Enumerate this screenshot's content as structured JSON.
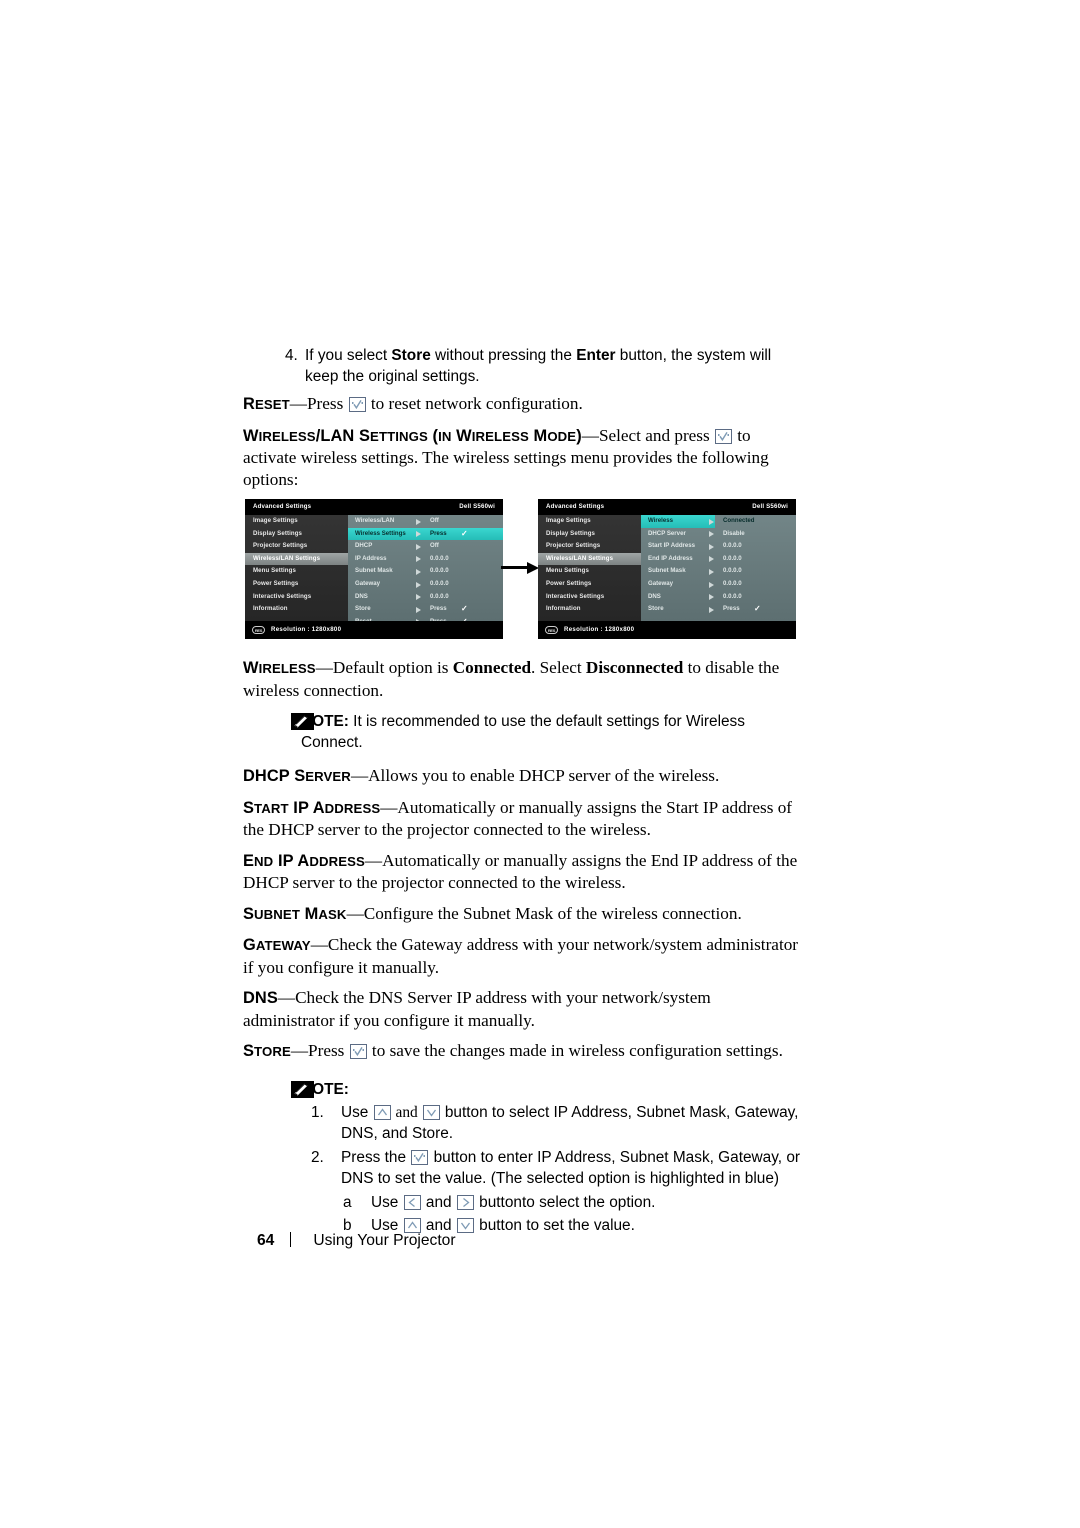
{
  "document": {
    "footer": {
      "page_number": "64",
      "section": "Using Your Projector"
    }
  },
  "numbered_item": {
    "number": "4.",
    "text_parts": {
      "a": "If you select ",
      "b_bold": "Store",
      "c": " without pressing the ",
      "d_bold": "Enter",
      "e": " button, the system will keep the original settings."
    },
    "full_text": "If you select Store without pressing the Enter button, the system will keep the original settings."
  },
  "definitions": [
    {
      "term": "RESET",
      "term_caps": "R",
      "term_smallcaps": "ESET",
      "body_before_icon": "—Press ",
      "icon": "enter-key-icon",
      "body_after_icon": " to reset network configuration."
    },
    {
      "term": "WIRELESS/LAN SETTINGS (IN WIRELESS MODE)",
      "body_before_icon": "—Select and press ",
      "icon": "enter-key-icon",
      "body_after_icon": " to activate wireless settings. The wireless settings menu provides the following options:"
    }
  ],
  "osd_left": {
    "title": "Advanced Settings",
    "model": "Dell  S560wi",
    "menu_items": [
      {
        "label": "Image Settings",
        "selected": false
      },
      {
        "label": "Display Settings",
        "selected": false
      },
      {
        "label": "Projector Settings",
        "selected": false
      },
      {
        "label": "Wireless/LAN Settings",
        "selected": true
      },
      {
        "label": "Menu Settings",
        "selected": false
      },
      {
        "label": "Power Settings",
        "selected": false
      },
      {
        "label": "Interactive Settings",
        "selected": false
      },
      {
        "label": "Information",
        "selected": false
      }
    ],
    "options": [
      {
        "label": "Wireless/LAN",
        "value": "Off",
        "check": false,
        "selected": false
      },
      {
        "label": "Wireless Settings",
        "value": "Press",
        "check": true,
        "selected": true
      },
      {
        "label": "DHCP",
        "value": "Off",
        "check": false,
        "selected": false
      },
      {
        "label": "IP Address",
        "value": "0.0.0.0",
        "check": false,
        "selected": false
      },
      {
        "label": "Subnet Mask",
        "value": "0.0.0.0",
        "check": false,
        "selected": false
      },
      {
        "label": "Gateway",
        "value": "0.0.0.0",
        "check": false,
        "selected": false
      },
      {
        "label": "DNS",
        "value": "0.0.0.0",
        "check": false,
        "selected": false
      },
      {
        "label": "Store",
        "value": "Press",
        "check": true,
        "selected": false
      },
      {
        "label": "Reset",
        "value": "Press",
        "check": true,
        "selected": false
      }
    ],
    "footer_icon_text": "RES",
    "footer_text": "Resolution : 1280x800"
  },
  "osd_right": {
    "title": "Advanced Settings",
    "model": "Dell  S560wi",
    "menu_items": [
      {
        "label": "Image Settings",
        "selected": false
      },
      {
        "label": "Display Settings",
        "selected": false
      },
      {
        "label": "Projector Settings",
        "selected": false
      },
      {
        "label": "Wireless/LAN Settings",
        "selected": true
      },
      {
        "label": "Menu Settings",
        "selected": false
      },
      {
        "label": "Power Settings",
        "selected": false
      },
      {
        "label": "Interactive Settings",
        "selected": false
      },
      {
        "label": "Information",
        "selected": false
      }
    ],
    "options": [
      {
        "label": "Wireless",
        "value": "Connected",
        "check": false,
        "selected": true
      },
      {
        "label": "DHCP Server",
        "value": "Disable",
        "check": false,
        "selected": false
      },
      {
        "label": "Start IP Address",
        "value": "0.0.0.0",
        "check": false,
        "selected": false
      },
      {
        "label": "End IP Address",
        "value": "0.0.0.0",
        "check": false,
        "selected": false
      },
      {
        "label": "Subnet Mask",
        "value": "0.0.0.0",
        "check": false,
        "selected": false
      },
      {
        "label": "Gateway",
        "value": "0.0.0.0",
        "check": false,
        "selected": false
      },
      {
        "label": "DNS",
        "value": "0.0.0.0",
        "check": false,
        "selected": false
      },
      {
        "label": "Store",
        "value": "Press",
        "check": true,
        "selected": false
      }
    ],
    "footer_icon_text": "RES",
    "footer_text": "Resolution : 1280x800"
  },
  "body": {
    "wireless": {
      "term": "WIRELESS",
      "p1": "—Default option is ",
      "bold1": "Connected",
      "p2": ". Select ",
      "bold2": "Disconnected",
      "p3": " to disable the wireless connection."
    },
    "note_wireless": {
      "label": "NOTE:",
      "text": " It is recommended to use the default settings for Wireless Connect."
    },
    "dhcp_server": {
      "term": "DHCP SERVER",
      "text": "—Allows you to enable DHCP server of the wireless."
    },
    "start_ip": {
      "term": "START IP ADDRESS",
      "text": "—Automatically or manually assigns the Start IP address of the DHCP server to the projector connected to the wireless."
    },
    "end_ip": {
      "term": "END IP ADDRESS",
      "text": "—Automatically or manually assigns the End IP address of the DHCP server to the projector connected to the wireless."
    },
    "subnet_mask": {
      "term": "SUBNET MASK",
      "text": "—Configure the Subnet Mask of the wireless connection."
    },
    "gateway": {
      "term": "GATEWAY",
      "text": "—Check the Gateway address with your network/system administrator if you configure it manually."
    },
    "dns": {
      "term": "DNS",
      "text": "—Check the DNS Server IP address with your network/system administrator if you configure it manually."
    },
    "store": {
      "term": "STORE",
      "before_icon": "—Press ",
      "after_icon": " to save the changes made in wireless configuration settings."
    }
  },
  "note_block": {
    "label": "NOTE:",
    "items": [
      {
        "marker": "1.",
        "a": "Use ",
        "icon1": "up-arrow-key-icon",
        "b": " and ",
        "icon2": "down-arrow-key-icon",
        "c": " button to select IP Address, Subnet Mask, Gateway, DNS, and Store."
      },
      {
        "marker": "2.",
        "a": "Press the ",
        "icon1": "enter-key-icon",
        "c": " button to enter IP Address, Subnet Mask, Gateway, or DNS to set the value. (The selected option is highlighted in blue)"
      },
      {
        "marker": "a",
        "a": "Use ",
        "icon1": "left-arrow-key-icon",
        "b": " and ",
        "icon2": "right-arrow-key-icon",
        "c": " buttonto select the option.",
        "sub": true
      },
      {
        "marker": "b",
        "a": "Use ",
        "icon1": "up-arrow-key-icon",
        "b": " and ",
        "icon2": "down-arrow-key-icon",
        "c": " button to set the value.",
        "sub": true
      }
    ]
  },
  "colors": {
    "osd_highlight_cyan": "#30cfc9",
    "osd_panel_teal": "#6f8284",
    "osd_sidebar_gray": "#2f2f2f",
    "key_icon_border": "#5b6b84",
    "key_icon_glyph": "#7f9bb5"
  }
}
